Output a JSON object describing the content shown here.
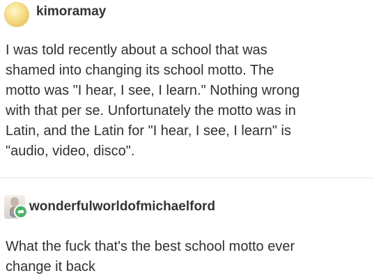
{
  "post_original": {
    "username": "kimoramay",
    "text": "I was told recently about a school that was\nshamed into changing its school motto. The\nmotto was \"I hear, I see, I learn.\" Nothing wrong\nwith that per se. Unfortunately the motto was in\nLatin, and the Latin for \"I hear, I see, I learn\" is\n\"audio, video, disco\"."
  },
  "post_reblog": {
    "username": "wonderfulworldofmichaelford",
    "text": "What the fuck that's the best school motto ever\nchange it back"
  },
  "colors": {
    "reblog_badge": "#4fb36b",
    "text": "#303030"
  }
}
